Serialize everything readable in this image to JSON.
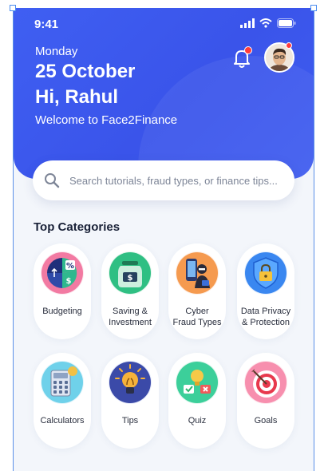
{
  "status_bar": {
    "time": "9:41"
  },
  "header": {
    "day": "Monday",
    "date": "25 October",
    "greeting": "Hi, Rahul",
    "welcome": "Welcome to Face2Finance"
  },
  "search": {
    "placeholder": "Search tutorials, fraud types, or finance tips..."
  },
  "categories_title": "Top Categories",
  "categories": [
    {
      "label": "Budgeting",
      "icon": "budget-pie-icon"
    },
    {
      "label": "Saving &\nInvestment",
      "icon": "money-jar-icon"
    },
    {
      "label": "Cyber\nFraud Types",
      "icon": "hacker-phone-icon"
    },
    {
      "label": "Data Privacy\n& Protection",
      "icon": "shield-lock-icon"
    },
    {
      "label": "Calculators",
      "icon": "calculator-icon"
    },
    {
      "label": "Tips",
      "icon": "lightbulb-icon"
    },
    {
      "label": "Quiz",
      "icon": "quiz-icon"
    },
    {
      "label": "Goals",
      "icon": "target-icon"
    }
  ],
  "colors": {
    "primary": "#3f5ff2",
    "background": "#f3f6fb"
  }
}
